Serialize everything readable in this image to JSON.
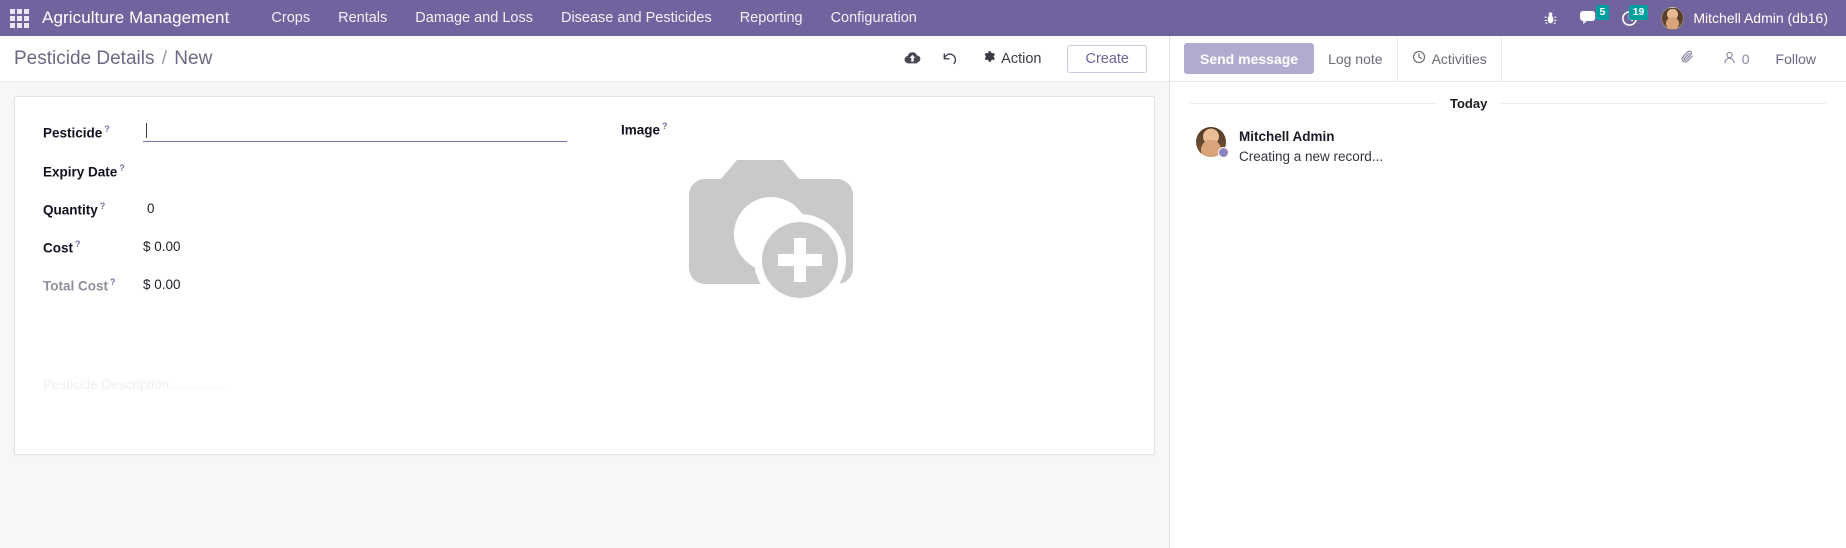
{
  "navbar": {
    "apps_icon": "apps-grid-icon",
    "brand": "Agriculture Management",
    "menus": [
      {
        "label": "Crops"
      },
      {
        "label": "Rentals"
      },
      {
        "label": "Damage and Loss"
      },
      {
        "label": "Disease and Pesticides"
      },
      {
        "label": "Reporting"
      },
      {
        "label": "Configuration"
      }
    ],
    "icons": [
      {
        "name": "debug-bug-icon",
        "glyph": "bug"
      },
      {
        "name": "messages-icon",
        "glyph": "chat",
        "badge": "5"
      },
      {
        "name": "activities-clock-icon",
        "glyph": "clock",
        "badge": "19"
      }
    ],
    "user": {
      "name": "Mitchell Admin (db16)",
      "avatar": "user-avatar"
    },
    "accent": "#71639e",
    "badge_color": "#00a09d"
  },
  "control_panel": {
    "breadcrumb_root": "Pesticide Details",
    "breadcrumb_sep": "/",
    "breadcrumb_current": "New",
    "save_icon": "cloud-upload-save-icon",
    "discard_icon": "undo-discard-icon",
    "action_label": "Action",
    "action_icon": "gear-icon",
    "create_label": "Create"
  },
  "form": {
    "fields": [
      {
        "label": "Pesticide",
        "help": "?",
        "type": "input",
        "value": "",
        "muted": false
      },
      {
        "label": "Expiry Date",
        "help": "?",
        "type": "date",
        "value": "",
        "muted": false
      },
      {
        "label": "Quantity",
        "help": "?",
        "type": "number",
        "value": "0",
        "muted": false
      },
      {
        "label": "Cost",
        "help": "?",
        "type": "money",
        "value": "$ 0.00",
        "muted": false
      },
      {
        "label": "Total Cost",
        "help": "?",
        "type": "money",
        "value": "$ 0.00",
        "muted": true
      }
    ],
    "image": {
      "label": "Image",
      "help": "?",
      "placeholder_icon": "camera-add-image-icon"
    },
    "description_placeholder": "Pesticide Description..............."
  },
  "chatter": {
    "send_message_label": "Send message",
    "log_note_label": "Log note",
    "activities_label": "Activities",
    "activities_icon": "clock-icon",
    "attachment_icon": "paperclip-icon",
    "followers_icon": "person-icon",
    "followers_count": "0",
    "follow_label": "Follow",
    "day_separator": "Today",
    "messages": [
      {
        "author": "Mitchell Admin",
        "body": "Creating a new record...",
        "avatar": "author-avatar",
        "status": "online"
      }
    ]
  }
}
